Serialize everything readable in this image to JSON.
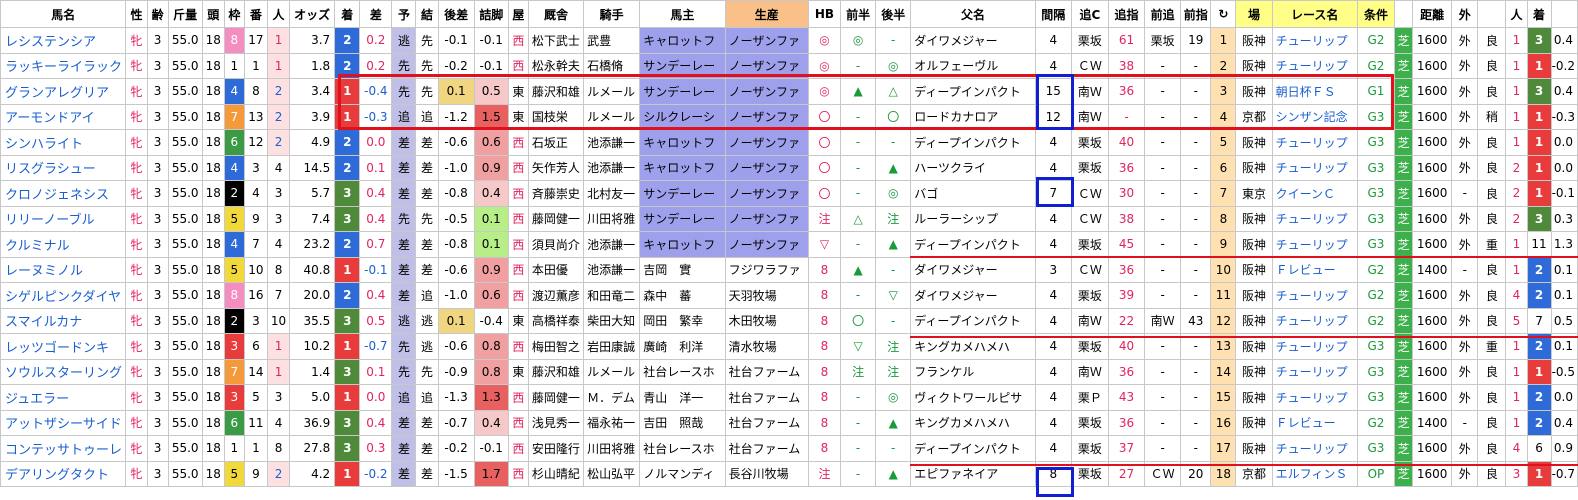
{
  "headers": [
    "馬名",
    "性",
    "齢",
    "斤量",
    "頭",
    "枠",
    "番",
    "人",
    "オッズ",
    "着",
    "差",
    "予",
    "結",
    "後差",
    "詰脚",
    "屋",
    "厩舎",
    "騎手",
    "馬主",
    "生産",
    "HB",
    "前半",
    "後半",
    "父名",
    "間隔",
    "追C",
    "追指",
    "前追",
    "前指",
    "↻",
    "場",
    "レース名",
    "条件",
    "",
    "距離",
    "外",
    "",
    "人",
    "着",
    ""
  ],
  "rows": [
    [
      "レシステンシア",
      "牝",
      "3",
      "55.0",
      "18",
      "8",
      "17",
      "1",
      "3.7",
      "2",
      "0.2",
      "逃",
      "先",
      "-0.1",
      "-0.1",
      "西",
      "松下武士",
      "武豊",
      "キャロットフ",
      "ノーザンファ",
      "◎",
      "◎",
      "-",
      "ダイワメジャー",
      "4",
      "栗坂",
      "61",
      "栗坂",
      "19",
      "1",
      "阪神",
      "チューリップ",
      "G2",
      "芝",
      "1600",
      "外",
      "良",
      "1",
      "3",
      "0.4"
    ],
    [
      "ラッキーライラック",
      "牝",
      "3",
      "55.0",
      "18",
      "1",
      "1",
      "1",
      "1.8",
      "2",
      "0.2",
      "先",
      "先",
      "-0.2",
      "-0.1",
      "西",
      "松永幹夫",
      "石橋脩",
      "サンデーレー",
      "ノーザンファ",
      "◎",
      "-",
      "◎",
      "オルフェーヴル",
      "4",
      "ＣＷ",
      "38",
      "-",
      "-",
      "2",
      "阪神",
      "チューリップ",
      "G2",
      "芝",
      "1600",
      "外",
      "良",
      "1",
      "1",
      "-0.2"
    ],
    [
      "グランアレグリア",
      "牝",
      "3",
      "55.0",
      "18",
      "4",
      "8",
      "2",
      "3.4",
      "1",
      "-0.4",
      "先",
      "先",
      "0.1",
      "0.5",
      "東",
      "藤沢和雄",
      "ルメール",
      "サンデーレー",
      "ノーザンファ",
      "◎",
      "▲",
      "△",
      "ディープインパクト",
      "15",
      "南Ｗ",
      "36",
      "-",
      "-",
      "3",
      "阪神",
      "朝日杯ＦＳ",
      "G1",
      "芝",
      "1600",
      "外",
      "良",
      "1",
      "3",
      "0.4"
    ],
    [
      "アーモンドアイ",
      "牝",
      "3",
      "55.0",
      "18",
      "7",
      "13",
      "2",
      "3.9",
      "1",
      "-0.3",
      "追",
      "追",
      "-1.2",
      "1.5",
      "東",
      "国枝栄",
      "ルメール",
      "シルクレーシ",
      "ノーザンファ",
      "〇",
      "-",
      "〇",
      "ロードカナロア",
      "12",
      "南Ｗ",
      "-",
      "-",
      "-",
      "4",
      "京都",
      "シンザン記念",
      "G3",
      "芝",
      "1600",
      "外",
      "稍",
      "1",
      "1",
      "-0.3"
    ],
    [
      "シンハライト",
      "牝",
      "3",
      "55.0",
      "18",
      "6",
      "12",
      "2",
      "4.9",
      "2",
      "0.0",
      "差",
      "差",
      "-0.6",
      "0.6",
      "西",
      "石坂正",
      "池添謙一",
      "キャロットフ",
      "ノーザンファ",
      "〇",
      "-",
      "-",
      "ディープインパクト",
      "4",
      "栗坂",
      "40",
      "-",
      "-",
      "5",
      "阪神",
      "チューリップ",
      "G3",
      "芝",
      "1600",
      "外",
      "良",
      "1",
      "1",
      "0.0"
    ],
    [
      "リスグラシュー",
      "牝",
      "3",
      "55.0",
      "18",
      "4",
      "3",
      "4",
      "14.5",
      "2",
      "0.1",
      "差",
      "差",
      "-1.0",
      "0.9",
      "西",
      "矢作芳人",
      "池添謙一",
      "キャロットフ",
      "ノーザンファ",
      "〇",
      "-",
      "▲",
      "ハーツクライ",
      "4",
      "栗坂",
      "36",
      "-",
      "-",
      "6",
      "阪神",
      "チューリップ",
      "G3",
      "芝",
      "1600",
      "外",
      "良",
      "2",
      "1",
      "0.0"
    ],
    [
      "クロノジェネシス",
      "牝",
      "3",
      "55.0",
      "18",
      "2",
      "4",
      "3",
      "5.7",
      "3",
      "0.4",
      "差",
      "差",
      "-0.8",
      "0.4",
      "西",
      "斉藤崇史",
      "北村友一",
      "サンデーレー",
      "ノーザンファ",
      "〇",
      "-",
      "◎",
      "バゴ",
      "7",
      "ＣＷ",
      "30",
      "-",
      "-",
      "7",
      "東京",
      "クイーンＣ",
      "G3",
      "芝",
      "1600",
      "-",
      "良",
      "2",
      "1",
      "-0.1"
    ],
    [
      "リリーノーブル",
      "牝",
      "3",
      "55.0",
      "18",
      "5",
      "9",
      "3",
      "7.4",
      "3",
      "0.4",
      "先",
      "先",
      "-0.5",
      "0.1",
      "西",
      "藤岡健一",
      "川田将雅",
      "サンデーレー",
      "ノーザンファ",
      "注",
      "△",
      "注",
      "ルーラーシップ",
      "4",
      "ＣＷ",
      "38",
      "-",
      "-",
      "8",
      "阪神",
      "チューリップ",
      "G3",
      "芝",
      "1600",
      "外",
      "良",
      "2",
      "3",
      "0.3"
    ],
    [
      "クルミナル",
      "牝",
      "3",
      "55.0",
      "18",
      "4",
      "7",
      "4",
      "23.2",
      "2",
      "0.7",
      "差",
      "差",
      "-0.8",
      "0.1",
      "西",
      "須貝尚介",
      "池添謙一",
      "キャロットフ",
      "ノーザンファ",
      "▽",
      "-",
      "▲",
      "ディープインパクト",
      "4",
      "栗坂",
      "45",
      "-",
      "-",
      "9",
      "阪神",
      "チューリップ",
      "G3",
      "芝",
      "1600",
      "外",
      "重",
      "1",
      "11",
      "1.3"
    ],
    [
      "レーヌミノル",
      "牝",
      "3",
      "55.0",
      "18",
      "5",
      "10",
      "8",
      "40.8",
      "1",
      "-0.1",
      "差",
      "差",
      "-0.6",
      "0.9",
      "西",
      "本田優",
      "池添謙一",
      "吉岡　實",
      "フジワラファ",
      "8",
      "▲",
      "-",
      "ダイワメジャー",
      "3",
      "ＣＷ",
      "36",
      "-",
      "-",
      "10",
      "阪神",
      "Ｆレビュー",
      "G2",
      "芝",
      "1400",
      "-",
      "良",
      "1",
      "2",
      "0.1"
    ],
    [
      "シゲルピンクダイヤ",
      "牝",
      "3",
      "55.0",
      "18",
      "8",
      "16",
      "7",
      "20.0",
      "2",
      "0.4",
      "差",
      "追",
      "-1.0",
      "0.6",
      "西",
      "渡辺薫彦",
      "和田竜二",
      "森中　蕃",
      "天羽牧場",
      "8",
      "-",
      "▽",
      "ダイワメジャー",
      "4",
      "栗坂",
      "39",
      "-",
      "-",
      "11",
      "阪神",
      "チューリップ",
      "G2",
      "芝",
      "1600",
      "外",
      "良",
      "4",
      "2",
      "0.1"
    ],
    [
      "スマイルカナ",
      "牝",
      "3",
      "55.0",
      "18",
      "2",
      "3",
      "10",
      "35.5",
      "3",
      "0.5",
      "逃",
      "逃",
      "0.1",
      "-0.4",
      "東",
      "高橋祥泰",
      "柴田大知",
      "岡田　繁幸",
      "木田牧場",
      "8",
      "〇",
      "-",
      "ディープインパクト",
      "4",
      "南Ｗ",
      "22",
      "南Ｗ",
      "43",
      "12",
      "阪神",
      "チューリップ",
      "G2",
      "芝",
      "1600",
      "外",
      "良",
      "5",
      "7",
      "0.5"
    ],
    [
      "レッツゴードンキ",
      "牝",
      "3",
      "55.0",
      "18",
      "3",
      "6",
      "1",
      "10.2",
      "1",
      "-0.7",
      "先",
      "逃",
      "-0.6",
      "0.8",
      "西",
      "梅田智之",
      "岩田康誠",
      "廣崎　利洋",
      "清水牧場",
      "8",
      "▽",
      "注",
      "キングカメハメハ",
      "4",
      "栗坂",
      "40",
      "-",
      "-",
      "13",
      "阪神",
      "チューリップ",
      "G3",
      "芝",
      "1600",
      "外",
      "重",
      "1",
      "2",
      "0.1"
    ],
    [
      "ソウルスターリング",
      "牝",
      "3",
      "55.0",
      "18",
      "7",
      "14",
      "1",
      "1.4",
      "3",
      "0.1",
      "先",
      "先",
      "-0.9",
      "0.8",
      "東",
      "藤沢和雄",
      "ルメール",
      "社台レースホ",
      "社台ファーム",
      "8",
      "注",
      "注",
      "フランケル",
      "4",
      "南Ｗ",
      "36",
      "-",
      "-",
      "14",
      "阪神",
      "チューリップ",
      "G3",
      "芝",
      "1600",
      "外",
      "良",
      "1",
      "1",
      "-0.5"
    ],
    [
      "ジュエラー",
      "牝",
      "3",
      "55.0",
      "18",
      "3",
      "5",
      "3",
      "5.0",
      "1",
      "0.0",
      "追",
      "追",
      "-1.3",
      "1.3",
      "西",
      "藤岡健一",
      "Ｍ．デム",
      "青山　洋一",
      "社台ファーム",
      "8",
      "-",
      "◎",
      "ヴィクトワールピサ",
      "4",
      "栗Ｐ",
      "43",
      "-",
      "-",
      "15",
      "阪神",
      "チューリップ",
      "G3",
      "芝",
      "1600",
      "外",
      "良",
      "1",
      "2",
      "0.0"
    ],
    [
      "アットザシーサイド",
      "牝",
      "3",
      "55.0",
      "18",
      "6",
      "11",
      "4",
      "36.9",
      "3",
      "0.4",
      "差",
      "差",
      "-0.7",
      "0.4",
      "西",
      "浅見秀一",
      "福永祐一",
      "吉田　照哉",
      "社台ファーム",
      "8",
      "-",
      "▲",
      "キングカメハメハ",
      "4",
      "栗坂",
      "36",
      "-",
      "-",
      "16",
      "阪神",
      "Ｆレビュー",
      "G2",
      "芝",
      "1400",
      "-",
      "良",
      "1",
      "2",
      "0.4"
    ],
    [
      "コンテッサトゥーレ",
      "牝",
      "3",
      "55.0",
      "18",
      "1",
      "1",
      "8",
      "27.8",
      "3",
      "0.3",
      "差",
      "差",
      "-0.2",
      "-0.1",
      "西",
      "安田隆行",
      "川田将雅",
      "社台レースホ",
      "社台ファーム",
      "8",
      "-",
      "-",
      "ディープインパクト",
      "4",
      "栗坂",
      "37",
      "-",
      "-",
      "17",
      "阪神",
      "チューリップ",
      "G3",
      "芝",
      "1600",
      "外",
      "良",
      "4",
      "6",
      "0.9"
    ],
    [
      "デアリングタクト",
      "牝",
      "3",
      "55.0",
      "18",
      "5",
      "9",
      "2",
      "4.2",
      "1",
      "-0.2",
      "差",
      "差",
      "-1.5",
      "1.7",
      "西",
      "杉山晴紀",
      "松山弘平",
      "ノルマンディ",
      "長谷川牧場",
      "注",
      "-",
      "▲",
      "エピファネイア",
      "8",
      "栗坂",
      "27",
      "ＣＷ",
      "20",
      "18",
      "京都",
      "エルフィンＳ",
      "OP",
      "芝",
      "1600",
      "外",
      "良",
      "3",
      "1",
      "-0.7"
    ]
  ]
}
